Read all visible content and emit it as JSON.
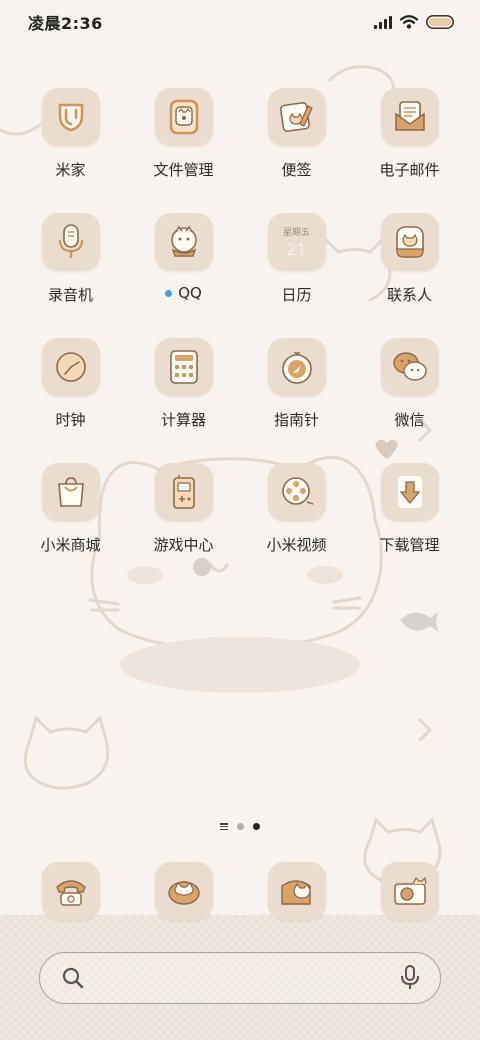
{
  "status_bar": {
    "time": "凌晨2:36",
    "icons": [
      "signal-icon",
      "wifi-icon",
      "battery-icon"
    ]
  },
  "home": {
    "apps": [
      {
        "label": "米家",
        "icon": "mi-home-icon"
      },
      {
        "label": "文件管理",
        "icon": "file-manager-icon"
      },
      {
        "label": "便签",
        "icon": "notes-icon"
      },
      {
        "label": "电子邮件",
        "icon": "email-icon"
      },
      {
        "label": "录音机",
        "icon": "recorder-icon"
      },
      {
        "label": "QQ",
        "icon": "qq-icon",
        "new_indicator": true
      },
      {
        "label": "日历",
        "icon": "calendar-icon",
        "calendar_weekday": "星期五",
        "calendar_day": "21"
      },
      {
        "label": "联系人",
        "icon": "contacts-icon"
      },
      {
        "label": "时钟",
        "icon": "clock-icon"
      },
      {
        "label": "计算器",
        "icon": "calculator-icon"
      },
      {
        "label": "指南针",
        "icon": "compass-icon"
      },
      {
        "label": "微信",
        "icon": "wechat-icon"
      },
      {
        "label": "小米商城",
        "icon": "mi-store-icon"
      },
      {
        "label": "游戏中心",
        "icon": "game-center-icon"
      },
      {
        "label": "小米视频",
        "icon": "mi-video-icon"
      },
      {
        "label": "下载管理",
        "icon": "downloads-icon"
      }
    ],
    "page_indicator": {
      "pages": 2,
      "current": 2
    }
  },
  "dock": {
    "apps": [
      {
        "icon": "phone-icon"
      },
      {
        "icon": "messages-icon"
      },
      {
        "icon": "browser-icon"
      },
      {
        "icon": "camera-icon"
      }
    ]
  },
  "search_bar": {
    "icons": [
      "search-icon",
      "microphone-icon"
    ]
  },
  "colors": {
    "background": "#f8f3ee",
    "icon_tile": "#eaddd0",
    "icon_accent": "#d9a36a",
    "icon_line": "#8a6a4e",
    "badge_blue": "#3aa6e6"
  }
}
